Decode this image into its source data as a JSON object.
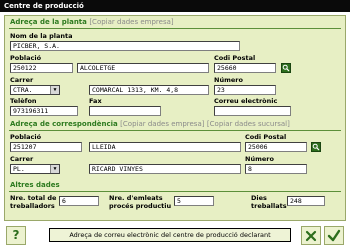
{
  "window": {
    "title": "Centre de producció"
  },
  "plant_address": {
    "heading": "Adreça de la planta",
    "copy_link": "[Copiar dades empresa]",
    "name_label": "Nom de la planta",
    "name_value": "PICBER, S.A.",
    "population_label": "Població",
    "population_code": "250122",
    "population_name": "ALCOLETGE",
    "postal_label": "Codi Postal",
    "postal_value": "25660",
    "street_label": "Carrer",
    "street_type": "CTRA.",
    "street_name": "COMARCAL 1313, KM. 4,8",
    "number_label": "Número",
    "number_value": "23",
    "phone_label": "Telèfon",
    "phone_value": "973196311",
    "fax_label": "Fax",
    "fax_value": "",
    "email_label": "Correu electrònic",
    "email_value": ""
  },
  "correspondence": {
    "heading": "Adreça de correspondència",
    "copy_company_link": "[Copiar dades empresa]",
    "copy_branch_link": "[Copiar dades sucursal]",
    "population_label": "Població",
    "population_code": "251207",
    "population_name": "LLEIDA",
    "postal_label": "Codi Postal",
    "postal_value": "25006",
    "street_label": "Carrer",
    "street_type": "PL.",
    "street_name": "RICARD VINYES",
    "number_label": "Número",
    "number_value": "8"
  },
  "other": {
    "heading": "Altres dades",
    "workers_label_1": "Nre. total de",
    "workers_label_2": "treballadors",
    "workers_value": "6",
    "employees_label_1": "Nre. d'emleats",
    "employees_label_2": "procés productiu",
    "employees_value": "5",
    "days_label_1": "Dies",
    "days_label_2": "treballats",
    "days_value": "248"
  },
  "footer": {
    "help_label": "?",
    "declare_label": "Adreça de correu electrònic del centre de producció declarant"
  }
}
